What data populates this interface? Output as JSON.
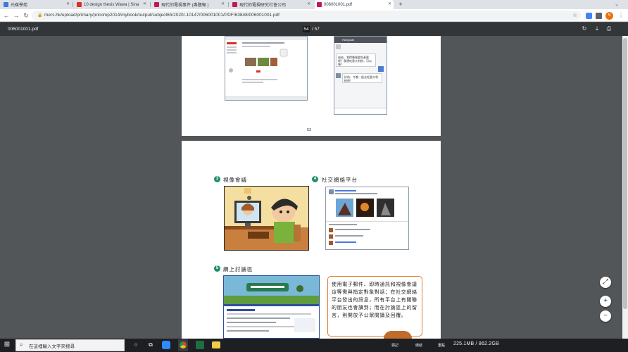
{
  "browser": {
    "tabs": [
      {
        "label": "光碟學苑",
        "favicon_color": "#3a7bd5"
      },
      {
        "label": "10 design thesis Wawa | Sina",
        "favicon_color": "#d93025"
      },
      {
        "label": "現代的電視事件 (專題報 )",
        "favicon_color": "#c2185b"
      },
      {
        "label": "現代的電視研究社會公司",
        "favicon_color": "#c2185b"
      },
      {
        "label": "006001001.pdf",
        "favicon_color": "#c2185b"
      }
    ],
    "new_tab": "+",
    "url": "mers.hk/upload/primary/pricomp2014/mybook/output/subject65/2020/-10147/006001001/PDF/63848/006001001.pdf",
    "avatar_letter": "S"
  },
  "pdf": {
    "filename": "006001001.pdf",
    "current_page": "54",
    "total_pages": "/ 57",
    "page53_number": "53",
    "chat_header": "Hangouts",
    "chat_msg1": "爸爸，我們晚餐要吃甚麼呢？我想吃意大利粉，可以嗎？",
    "chat_msg2": "好的，今晚一起去吃意大利粉吧！",
    "sections": [
      {
        "num": "3",
        "title": "視像會議"
      },
      {
        "num": "4",
        "title": "社交網絡平台"
      },
      {
        "num": "5",
        "title": "網上討論區"
      }
    ],
    "note": "使用電子郵件、即時通訊和視像會議這等需與指定對象對話；在社交網絡平台發出的訊息，所有平台上有關聯的朋友也會讀到；而在討論區上的留言，則開放予公眾閱讀及回覆。"
  },
  "zoom": {
    "fit": "⤢",
    "plus": "+",
    "minus": "−"
  },
  "taskbar": {
    "search_placeholder": "在這裡輸入文字來搜尋",
    "disk_info": "225.1MB / 862.2GB",
    "mascot_labels": [
      "標記",
      "總結",
      "重點"
    ]
  }
}
